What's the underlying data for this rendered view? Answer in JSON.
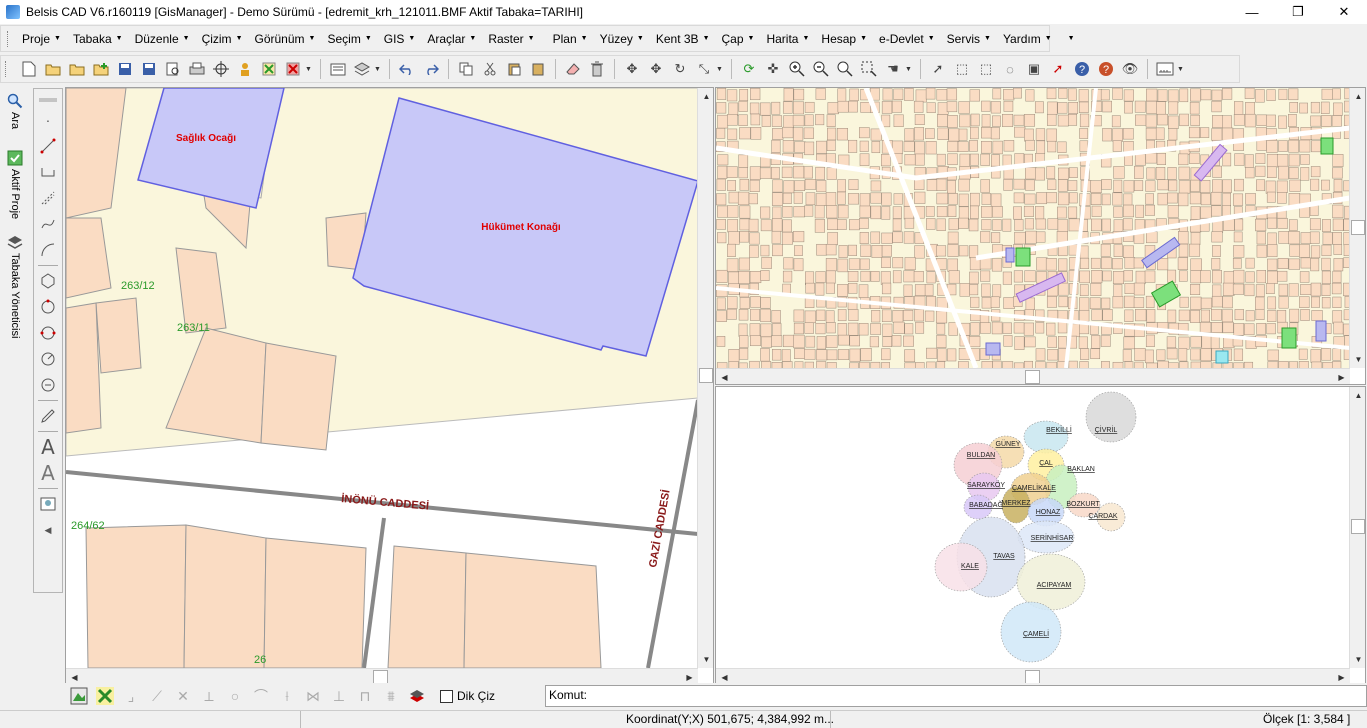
{
  "window": {
    "title": "Belsis CAD V6.r160119 [GisManager] - Demo Sürümü - [edremit_krh_121011.BMF  Aktif Tabaka=TARIHI]",
    "minimize": "—",
    "maximize": "❐",
    "close": "✕"
  },
  "menu": {
    "items": [
      "Proje",
      "Tabaka",
      "Düzenle",
      "Çizim",
      "Görünüm",
      "Seçim",
      "GIS",
      "Araçlar",
      "Raster",
      "Plan",
      "Yüzey",
      "Kent 3B",
      "Çap",
      "Harita",
      "Hesap",
      "e-Devlet",
      "Servis",
      "Yardım"
    ]
  },
  "left_tabs": {
    "search": "Ara",
    "active_project": "Aktif Proje",
    "layer_manager": "Tabaka Yöneticisi"
  },
  "drawing_tools": {
    "text_a": "A",
    "text_a2": "A"
  },
  "main_map": {
    "labels": {
      "saglik": "Sağlık Ocağı",
      "hukumet": "Hükümet Konağı",
      "parcel_263_12": "263/12",
      "parcel_263_11": "263/11",
      "parcel_264": "264/62",
      "parcel_26": "26",
      "inonu": "İNÖNÜ CADDESİ",
      "gazi": "GAZİ CADDESİ"
    }
  },
  "overview_map": {
    "districts": [
      "BEKİLLİ",
      "ÇİVRİL",
      "GÜNEY",
      "BULDAN",
      "ÇAL",
      "BAKLAN",
      "SARAYKÖY",
      "ÇAMELİKALE",
      "BABADAĞ",
      "MERKEZ",
      "HONAZ",
      "BOZKURT",
      "ÇARDAK",
      "SERİNHİSAR",
      "TAVAS",
      "KALE",
      "ACIPAYAM",
      "ÇAMELİ"
    ],
    "district_colors": [
      "#c8e6f0",
      "#d8d8d8",
      "#f4d9a8",
      "#f6cfd4",
      "#fff0a0",
      "#c8f0c0",
      "#e8c8f0",
      "#f0d090",
      "#d8c8f8",
      "#c8b060",
      "#c8d8f8",
      "#f8d8c8",
      "#f8e8d0",
      "#dde8f8",
      "#d8e0f0",
      "#f8e0e8",
      "#f0f0d8",
      "#d0e8f8"
    ]
  },
  "bottom": {
    "dik_ciz": "Dik Çiz",
    "komut": "Komut:"
  },
  "status": {
    "coords": "Koordinat(Y;X)  501,675; 4,384,992 m...",
    "scale": "Ölçek [1: 3,584 ]"
  }
}
